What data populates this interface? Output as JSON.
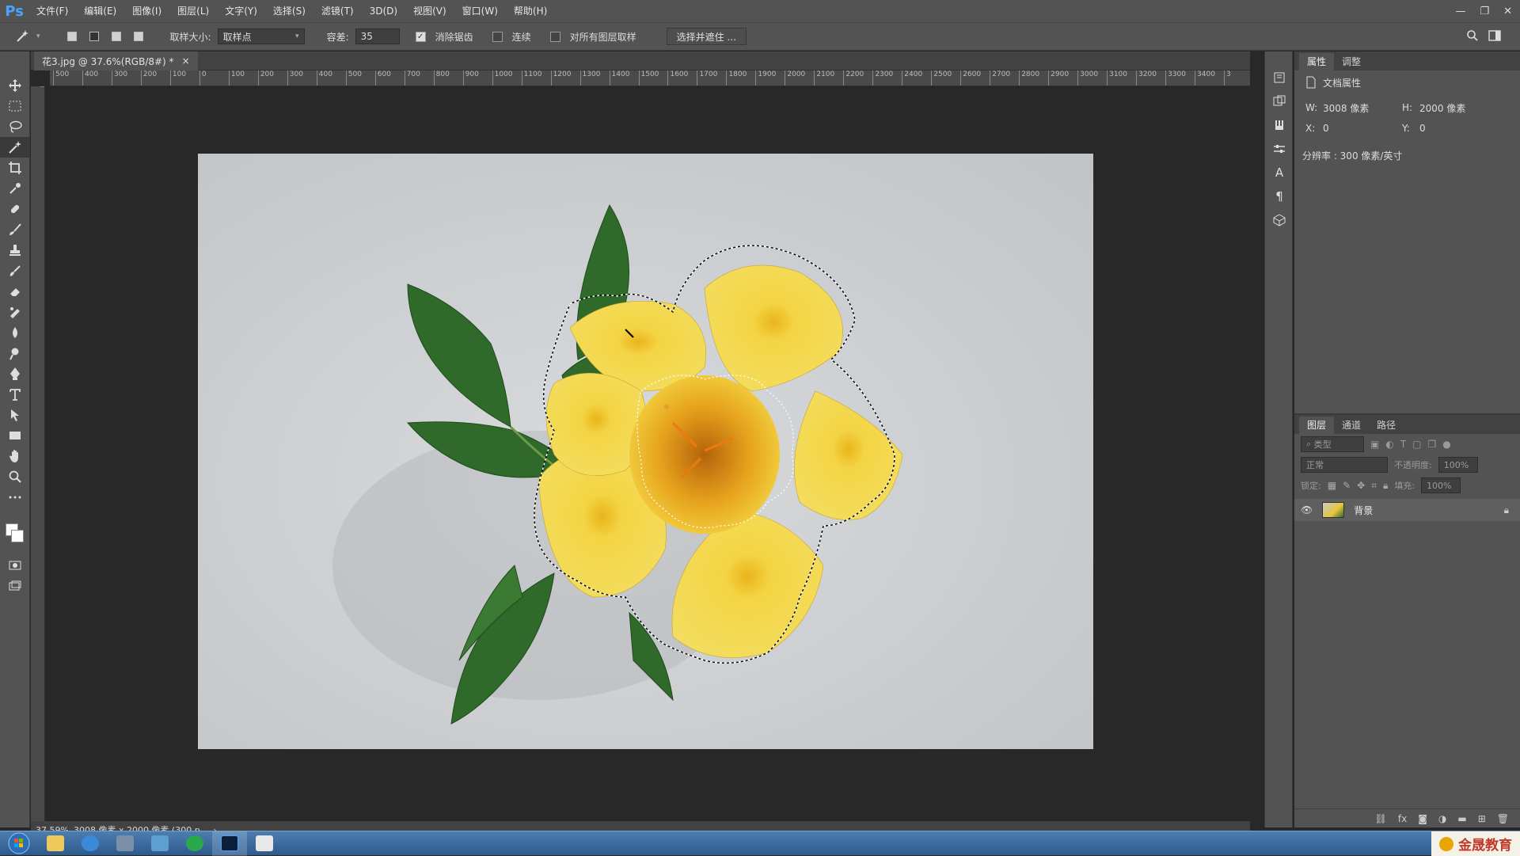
{
  "app": {
    "logo": "Ps"
  },
  "menu": [
    "文件(F)",
    "编辑(E)",
    "图像(I)",
    "图层(L)",
    "文字(Y)",
    "选择(S)",
    "滤镜(T)",
    "3D(D)",
    "视图(V)",
    "窗口(W)",
    "帮助(H)"
  ],
  "options": {
    "sample_size_label": "取样大小:",
    "sample_size_value": "取样点",
    "tolerance_label": "容差:",
    "tolerance_value": "35",
    "antialias_label": "消除锯齿",
    "antialias_checked": true,
    "contiguous_label": "连续",
    "contiguous_checked": false,
    "sample_all_label": "对所有图层取样",
    "sample_all_checked": false,
    "select_mask_label": "选择并遮住 ..."
  },
  "document": {
    "tab_title": "花3.jpg @ 37.6%(RGB/8#) *",
    "close": "×"
  },
  "ruler": {
    "ticks": [
      "500",
      "400",
      "300",
      "200",
      "100",
      "0",
      "100",
      "200",
      "300",
      "400",
      "500",
      "600",
      "700",
      "800",
      "900",
      "1000",
      "1100",
      "1200",
      "1300",
      "1400",
      "1500",
      "1600",
      "1700",
      "1800",
      "1900",
      "2000",
      "2100",
      "2200",
      "2300",
      "2400",
      "2500",
      "2600",
      "2700",
      "2800",
      "2900",
      "3000",
      "3100",
      "3200",
      "3300",
      "3400",
      "3"
    ]
  },
  "status": {
    "zoom": "37.59%",
    "info": "3008 像素 x 2000 像素 (300 p...",
    "arrow": "›"
  },
  "properties_panel": {
    "tabs": [
      "属性",
      "调整"
    ],
    "doc_label": "文档属性",
    "w_label": "W:",
    "w_value": "3008 像素",
    "h_label": "H:",
    "h_value": "2000 像素",
    "x_label": "X:",
    "x_value": "0",
    "y_label": "Y:",
    "y_value": "0",
    "resolution": "分辨率 : 300 像素/英寸"
  },
  "layers_panel": {
    "tabs": [
      "图层",
      "通道",
      "路径"
    ],
    "filter_placeholder": "类型",
    "blend_mode": "正常",
    "opacity_label": "不透明度:",
    "opacity_value": "100%",
    "lock_label": "锁定:",
    "fill_label": "填充:",
    "fill_value": "100%",
    "layer_name": "背景"
  },
  "taskbar": {
    "brand": "金晟教育"
  },
  "colors": {
    "accent": "#4aa3ff",
    "panel": "#535353",
    "canvas_bg": "#282828",
    "flower": "#f2d23c",
    "leaf": "#2f6a2a"
  },
  "icons": [
    "move-icon",
    "marquee-icon",
    "lasso-icon",
    "magic-wand-icon",
    "crop-icon",
    "eyedropper-icon",
    "healing-icon",
    "brush-icon",
    "stamp-icon",
    "history-brush-icon",
    "eraser-icon",
    "gradient-icon",
    "blur-icon",
    "dodge-icon",
    "pen-icon",
    "type-icon",
    "path-select-icon",
    "rectangle-icon",
    "hand-icon",
    "zoom-icon",
    "more-icon"
  ]
}
